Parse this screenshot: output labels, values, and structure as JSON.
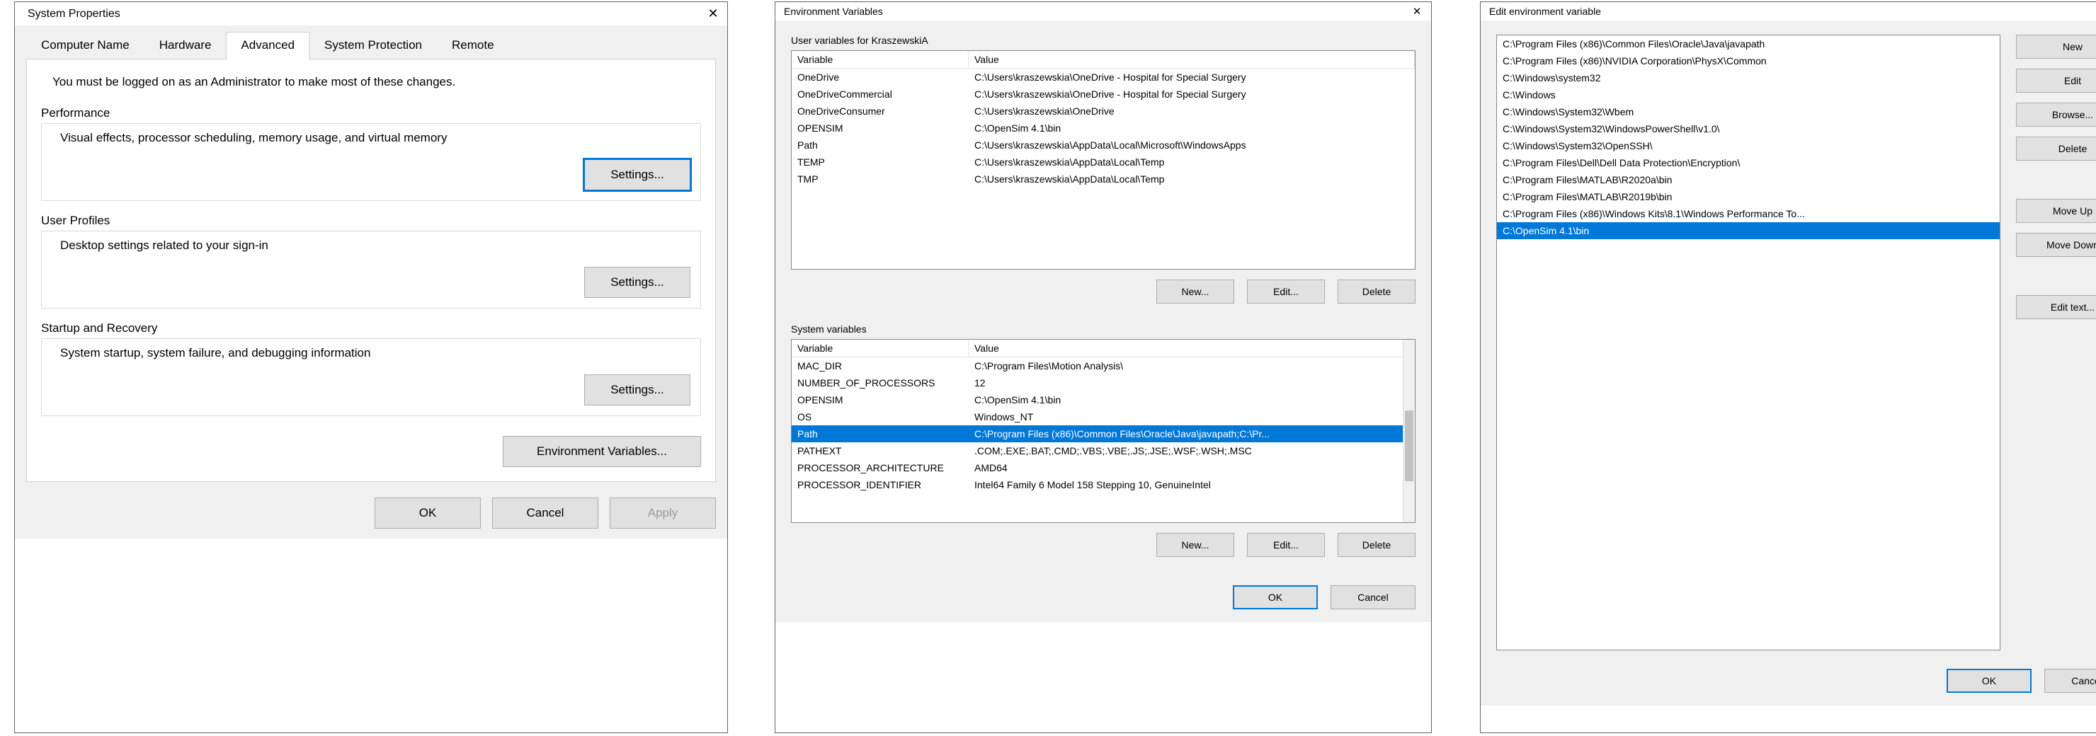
{
  "sysprop": {
    "title": "System Properties",
    "tabs": [
      "Computer Name",
      "Hardware",
      "Advanced",
      "System Protection",
      "Remote"
    ],
    "activeTab": 2,
    "admin_notice": "You must be logged on as an Administrator to make most of these changes.",
    "perf_head": "Performance",
    "perf_desc": "Visual effects, processor scheduling, memory usage, and virtual memory",
    "profiles_head": "User Profiles",
    "profiles_desc": "Desktop settings related to your sign-in",
    "startup_head": "Startup and Recovery",
    "startup_desc": "System startup, system failure, and debugging information",
    "settings_btn": "Settings...",
    "env_btn": "Environment Variables...",
    "ok": "OK",
    "cancel": "Cancel",
    "apply": "Apply"
  },
  "env": {
    "title": "Environment Variables",
    "user_label": "User variables for KraszewskiA",
    "col_var": "Variable",
    "col_val": "Value",
    "user_vars": [
      {
        "name": "OneDrive",
        "value": "C:\\Users\\kraszewskia\\OneDrive - Hospital for Special Surgery"
      },
      {
        "name": "OneDriveCommercial",
        "value": "C:\\Users\\kraszewskia\\OneDrive - Hospital for Special Surgery"
      },
      {
        "name": "OneDriveConsumer",
        "value": "C:\\Users\\kraszewskia\\OneDrive"
      },
      {
        "name": "OPENSIM",
        "value": "C:\\OpenSim 4.1\\bin"
      },
      {
        "name": "Path",
        "value": "C:\\Users\\kraszewskia\\AppData\\Local\\Microsoft\\WindowsApps"
      },
      {
        "name": "TEMP",
        "value": "C:\\Users\\kraszewskia\\AppData\\Local\\Temp"
      },
      {
        "name": "TMP",
        "value": "C:\\Users\\kraszewskia\\AppData\\Local\\Temp"
      }
    ],
    "sys_label": "System variables",
    "sys_vars": [
      {
        "name": "MAC_DIR",
        "value": "C:\\Program Files\\Motion Analysis\\"
      },
      {
        "name": "NUMBER_OF_PROCESSORS",
        "value": "12"
      },
      {
        "name": "OPENSIM",
        "value": "C:\\OpenSim 4.1\\bin"
      },
      {
        "name": "OS",
        "value": "Windows_NT"
      },
      {
        "name": "Path",
        "value": "C:\\Program Files (x86)\\Common Files\\Oracle\\Java\\javapath;C:\\Pr..."
      },
      {
        "name": "PATHEXT",
        "value": ".COM;.EXE;.BAT;.CMD;.VBS;.VBE;.JS;.JSE;.WSF;.WSH;.MSC"
      },
      {
        "name": "PROCESSOR_ARCHITECTURE",
        "value": "AMD64"
      },
      {
        "name": "PROCESSOR_IDENTIFIER",
        "value": "Intel64 Family 6 Model 158 Stepping 10, GenuineIntel"
      }
    ],
    "sys_selected": 4,
    "new_btn": "New...",
    "edit_btn": "Edit...",
    "delete_btn": "Delete",
    "ok": "OK",
    "cancel": "Cancel"
  },
  "edit": {
    "title": "Edit environment variable",
    "items": [
      "C:\\Program Files (x86)\\Common Files\\Oracle\\Java\\javapath",
      "C:\\Program Files (x86)\\NVIDIA Corporation\\PhysX\\Common",
      "C:\\Windows\\system32",
      "C:\\Windows",
      "C:\\Windows\\System32\\Wbem",
      "C:\\Windows\\System32\\WindowsPowerShell\\v1.0\\",
      "C:\\Windows\\System32\\OpenSSH\\",
      "C:\\Program Files\\Dell\\Dell Data Protection\\Encryption\\",
      "C:\\Program Files\\MATLAB\\R2020a\\bin",
      "C:\\Program Files\\MATLAB\\R2019b\\bin",
      "C:\\Program Files (x86)\\Windows Kits\\8.1\\Windows Performance To...",
      "C:\\OpenSim 4.1\\bin"
    ],
    "selected": 11,
    "btn_new": "New",
    "btn_edit": "Edit",
    "btn_browse": "Browse...",
    "btn_delete": "Delete",
    "btn_up": "Move Up",
    "btn_down": "Move Down",
    "btn_edittext": "Edit text...",
    "ok": "OK",
    "cancel": "Cancel"
  }
}
